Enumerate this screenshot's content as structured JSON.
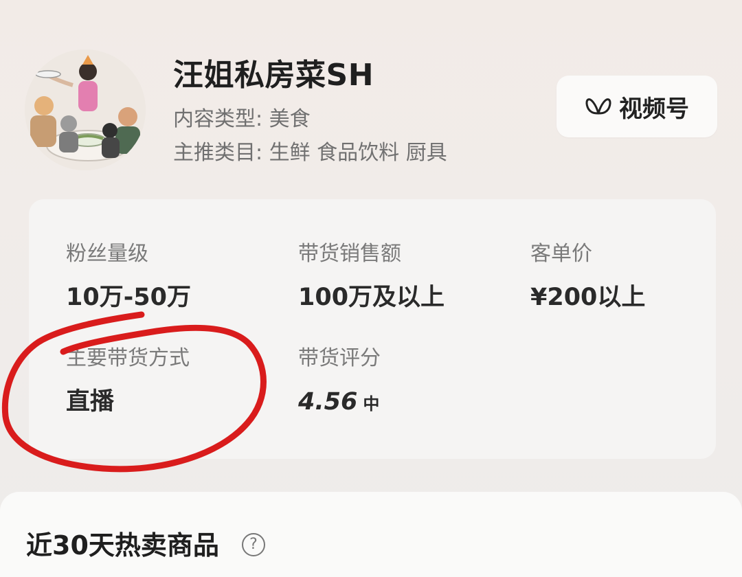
{
  "profile": {
    "name": "汪姐私房菜SH",
    "content_type": "内容类型: 美食",
    "main_categories": "主推类目: 生鲜 食品饮料 厨具",
    "avatar_icon": "avatar-illustration-icon"
  },
  "platform_button": {
    "label": "视频号",
    "icon": "butterfly-icon"
  },
  "stats": {
    "fans": {
      "label": "粉丝量级",
      "value": "10万-50万"
    },
    "sales": {
      "label": "带货销售额",
      "value": "100万及以上"
    },
    "unit_price": {
      "label": "客单价",
      "value": "¥200以上"
    },
    "main_method": {
      "label": "主要带货方式",
      "value": "直播"
    },
    "rating": {
      "label": "带货评分",
      "value": "4.56",
      "level": "中"
    }
  },
  "hot_products": {
    "title": "近30天热卖商品",
    "help_icon": "question-mark-icon",
    "help_glyph": "?"
  },
  "annotation": {
    "color": "#d91c1c"
  }
}
